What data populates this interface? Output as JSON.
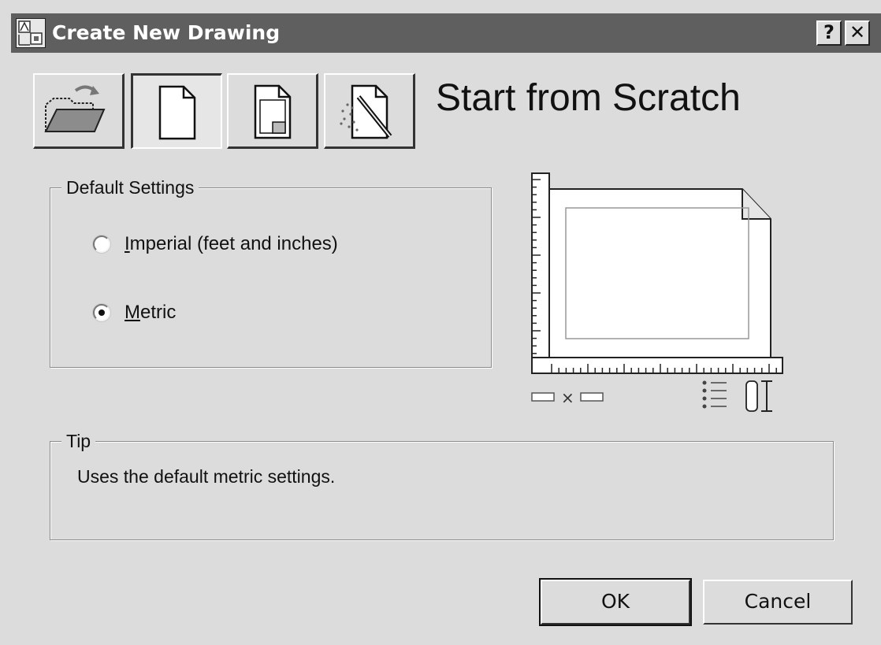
{
  "window": {
    "title": "Create New Drawing",
    "help_label": "?",
    "close_label": "✕"
  },
  "mode_buttons": [
    {
      "name": "open-drawing",
      "icon": "open-folder-icon"
    },
    {
      "name": "start-from-scratch",
      "icon": "blank-page-icon",
      "selected": true
    },
    {
      "name": "use-template",
      "icon": "template-page-icon"
    },
    {
      "name": "use-wizard",
      "icon": "wizard-wand-icon"
    }
  ],
  "heading": "Start from Scratch",
  "default_settings": {
    "label": "Default Settings",
    "options": [
      {
        "label": "Imperial (feet and inches)",
        "checked": false
      },
      {
        "label": "Metric",
        "checked": true
      }
    ]
  },
  "preview": {
    "times_symbol": "×"
  },
  "tip": {
    "label": "Tip",
    "text": "Uses the default metric settings."
  },
  "buttons": {
    "ok_label": "OK",
    "cancel_label": "Cancel"
  }
}
